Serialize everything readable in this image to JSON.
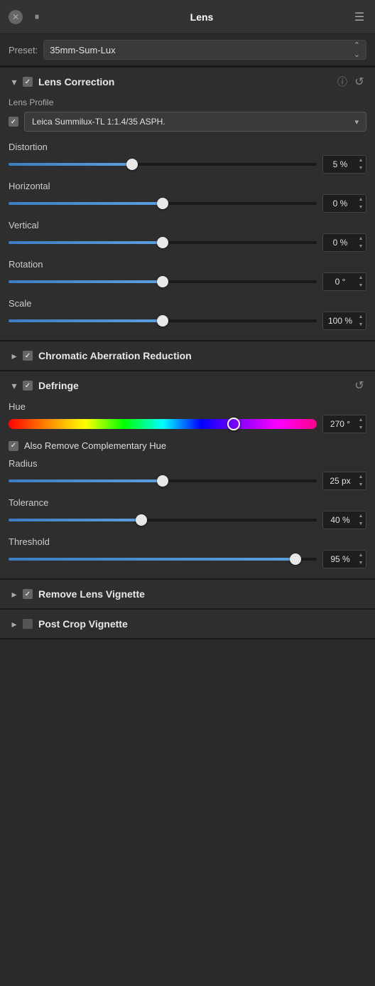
{
  "header": {
    "close_label": "✕",
    "pause_label": "⏸",
    "title": "Lens",
    "menu_label": "≡"
  },
  "preset": {
    "label": "Preset:",
    "value": "35mm-Sum-Lux"
  },
  "lens_correction": {
    "title": "Lens Correction",
    "lens_profile_label": "Lens Profile",
    "profile_name": "Leica Summilux-TL 1:1.4/35 ASPH.",
    "distortion_label": "Distortion",
    "distortion_value": "5 %",
    "distortion_pct": 40,
    "horizontal_label": "Horizontal",
    "horizontal_value": "0 %",
    "horizontal_pct": 50,
    "vertical_label": "Vertical",
    "vertical_value": "0 %",
    "vertical_pct": 50,
    "rotation_label": "Rotation",
    "rotation_value": "0 °",
    "rotation_pct": 50,
    "scale_label": "Scale",
    "scale_value": "100 %",
    "scale_pct": 50
  },
  "chromatic_aberration": {
    "title": "Chromatic Aberration Reduction"
  },
  "defringe": {
    "title": "Defringe",
    "hue_label": "Hue",
    "hue_value": "270 °",
    "hue_pct": 73,
    "also_remove_label": "Also Remove Complementary Hue",
    "radius_label": "Radius",
    "radius_value": "25 px",
    "radius_pct": 50,
    "tolerance_label": "Tolerance",
    "tolerance_value": "40 %",
    "tolerance_pct": 43,
    "threshold_label": "Threshold",
    "threshold_value": "95 %",
    "threshold_pct": 93
  },
  "remove_lens_vignette": {
    "title": "Remove Lens Vignette"
  },
  "post_crop_vignette": {
    "title": "Post Crop Vignette"
  },
  "icons": {
    "chevron_down": "▾",
    "chevron_right": "▸",
    "check": "✓",
    "up": "▲",
    "down": "▼",
    "info": "ⓘ",
    "reset": "↺",
    "menu": "☰"
  }
}
